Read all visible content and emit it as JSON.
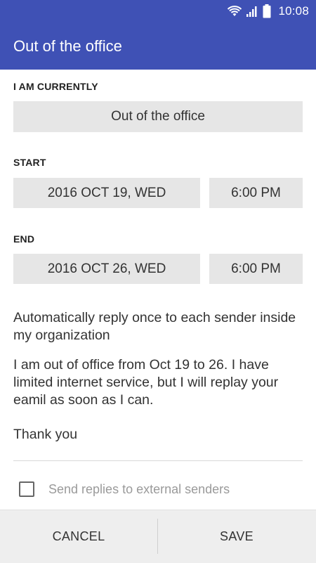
{
  "status_bar": {
    "time": "10:08",
    "icons": [
      "wifi-icon",
      "signal-icon",
      "battery-icon"
    ]
  },
  "app_bar": {
    "title": "Out of the office"
  },
  "status_section": {
    "label": "I AM CURRENTLY",
    "value": "Out of the office"
  },
  "start": {
    "label": "START",
    "date": "2016 OCT 19, WED",
    "time": "6:00 PM"
  },
  "end": {
    "label": "END",
    "date": "2016 OCT 26, WED",
    "time": "6:00 PM"
  },
  "message": {
    "intro": "Automatically reply once to each sender inside my organization",
    "body": "I am out of office from Oct  19 to 26. I have limited internet service, but I will replay your eamil as soon as I can.",
    "closing": "Thank you"
  },
  "external": {
    "label": "Send replies to external senders",
    "checked": false
  },
  "actions": {
    "cancel": "CANCEL",
    "save": "SAVE"
  },
  "colors": {
    "primary": "#3f51b5",
    "field_bg": "#e6e6e6",
    "bottom_bar": "#eeeeee"
  }
}
